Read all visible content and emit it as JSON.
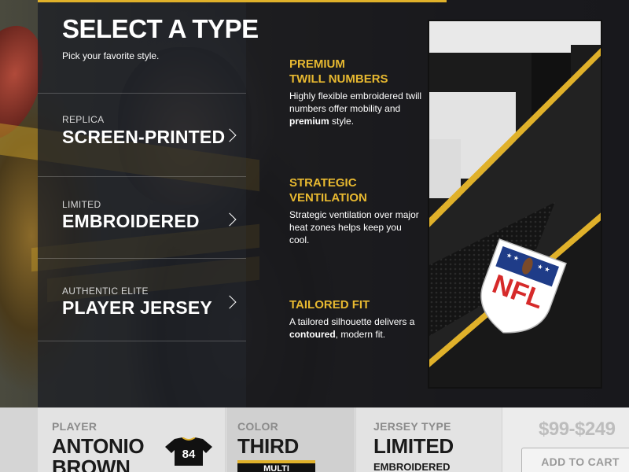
{
  "header": {
    "title": "SELECT A TYPE",
    "subtitle": "Pick your favorite style."
  },
  "type_options": [
    {
      "tier": "REPLICA",
      "name": "SCREEN-PRINTED"
    },
    {
      "tier": "LIMITED",
      "name": "EMBROIDERED"
    },
    {
      "tier": "AUTHENTIC ELITE",
      "name": "PLAYER JERSEY"
    }
  ],
  "features": [
    {
      "title_line1": "PREMIUM",
      "title_line2": "TWILL NUMBERS",
      "desc_a": "Highly flexible embroidered twill numbers offer mobility and ",
      "desc_bold": "premium",
      "desc_b": " style."
    },
    {
      "title_line1": "STRATEGIC",
      "title_line2": "VENTILATION",
      "desc_a": "Strategic ventilation over major heat zones helps keep you cool.",
      "desc_bold": "",
      "desc_b": ""
    },
    {
      "title_line1": "TAILORED FIT",
      "title_line2": "",
      "desc_a": "A tailored silhouette delivers a ",
      "desc_bold": "contoured",
      "desc_b": ", modern fit."
    }
  ],
  "jersey_image": {
    "logo_text": "NFL",
    "accent": "#e0b12a"
  },
  "summary": {
    "player_label": "PLAYER",
    "player_name_line1": "ANTONIO",
    "player_name_line2": "BROWN",
    "jersey_number": "84",
    "color_label": "COLOR",
    "color_value": "THIRD",
    "color_chip": "MULTI",
    "type_label": "JERSEY TYPE",
    "type_value": "LIMITED",
    "type_sub": "EMBROIDERED",
    "price": "$99-$249",
    "cart_button": "ADD TO CART"
  },
  "colors": {
    "accent": "#e0b12a",
    "feature_title": "#e8b930",
    "bar_bg": "#e6e6e6"
  }
}
